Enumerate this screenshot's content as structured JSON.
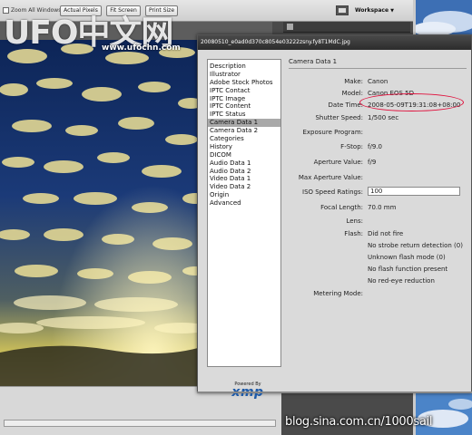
{
  "toolbar": {
    "zoom_all_windows": "Zoom All Windows",
    "actual_pixels": "Actual Pixels",
    "fit_screen": "Fit Screen",
    "print_size": "Print Size",
    "workspace": "Workspace",
    "workspace_arrow": "▼"
  },
  "watermark": {
    "logo_text": "UFO中文网",
    "logo_url": "www.ufochn.com",
    "blog": "blog.sina.com.cn/1000sail"
  },
  "dialog": {
    "title": "20080510_e0ad0d370c8054e03222zsny.fy8T1MdC.jpg",
    "categories": [
      "Description",
      "Illustrator",
      "Adobe Stock Photos",
      "IPTC Contact",
      "IPTC Image",
      "IPTC Content",
      "IPTC Status",
      "Camera Data 1",
      "Camera Data 2",
      "Categories",
      "History",
      "DICOM",
      "Audio Data 1",
      "Audio Data 2",
      "Video Data 1",
      "Video Data 2",
      "Origin",
      "Advanced"
    ],
    "selected_category": "Camera Data 1",
    "powered_by": "Powered By",
    "xmp_logo": "xmp",
    "section_title": "Camera Data 1",
    "make_label": "Make:",
    "make_value": "Canon",
    "model_label": "Model:",
    "model_value": "Canon EOS 5D",
    "datetime_label": "Date Time:",
    "datetime_value": "2008-05-09T19:31:08+08:00",
    "shutter_label": "Shutter Speed:",
    "shutter_value": "1/500 sec",
    "exposure_label": "Exposure Program:",
    "exposure_value": "",
    "fstop_label": "F-Stop:",
    "fstop_value": "f/9.0",
    "aperture_label": "Aperture Value:",
    "aperture_value": "f/9",
    "maxaperture_label": "Max Aperture Value:",
    "maxaperture_value": "",
    "iso_label": "ISO Speed Ratings:",
    "iso_value": "100",
    "focal_label": "Focal Length:",
    "focal_value": "70.0 mm",
    "lens_label": "Lens:",
    "lens_value": "",
    "flash_label": "Flash:",
    "flash_values": [
      "Did not fire",
      "No strobe return detection (0)",
      "Unknown flash mode (0)",
      "No flash function present",
      "No red-eye reduction"
    ],
    "metering_label": "Metering Mode:",
    "metering_value": ""
  },
  "colors": {
    "highlight": "#e0103c",
    "xmp_blue": "#1e5aa8",
    "selected_row": "#a9a9a9"
  }
}
